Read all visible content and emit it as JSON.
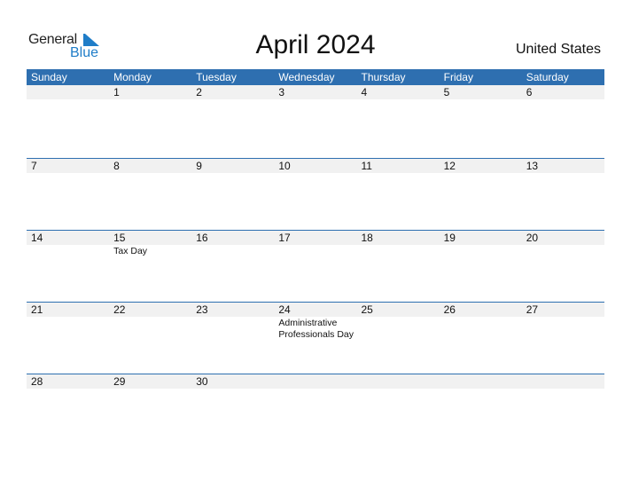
{
  "logo": {
    "word1": "General",
    "word2": "Blue"
  },
  "title": "April 2024",
  "country": "United States",
  "colors": {
    "accent": "#2e6fb0",
    "date_band": "#f1f1f1",
    "logo_blue": "#1f7dc8"
  },
  "weekdays": [
    "Sunday",
    "Monday",
    "Tuesday",
    "Wednesday",
    "Thursday",
    "Friday",
    "Saturday"
  ],
  "weeks": [
    {
      "dates": [
        "",
        "1",
        "2",
        "3",
        "4",
        "5",
        "6"
      ],
      "events": [
        "",
        "",
        "",
        "",
        "",
        "",
        ""
      ]
    },
    {
      "dates": [
        "7",
        "8",
        "9",
        "10",
        "11",
        "12",
        "13"
      ],
      "events": [
        "",
        "",
        "",
        "",
        "",
        "",
        ""
      ]
    },
    {
      "dates": [
        "14",
        "15",
        "16",
        "17",
        "18",
        "19",
        "20"
      ],
      "events": [
        "",
        "Tax Day",
        "",
        "",
        "",
        "",
        ""
      ]
    },
    {
      "dates": [
        "21",
        "22",
        "23",
        "24",
        "25",
        "26",
        "27"
      ],
      "events": [
        "",
        "",
        "",
        "Administrative Professionals Day",
        "",
        "",
        ""
      ]
    },
    {
      "dates": [
        "28",
        "29",
        "30",
        "",
        "",
        "",
        ""
      ],
      "events": [
        "",
        "",
        "",
        "",
        "",
        "",
        ""
      ]
    }
  ]
}
